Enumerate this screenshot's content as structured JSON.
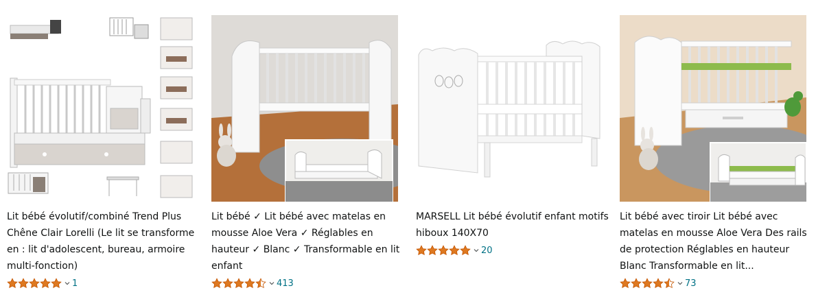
{
  "colors": {
    "star": "#de7921",
    "star_empty": "#ffffff",
    "link": "#007185",
    "text": "#0f1111"
  },
  "products": [
    {
      "title": "Lit bébé évolutif/combiné Trend Plus Chêne Clair Lorelli (Le lit se transforme en : lit d'adolescent, bureau, armoire multi-fonction)",
      "stars": 5,
      "rating_count": "1",
      "image_icon": "convertible-crib-collage-image"
    },
    {
      "title": "Lit bébé ✓ Lit bébé avec matelas en mousse Aloe Vera ✓ Réglables en hauteur ✓ Blanc ✓ Transformable en lit enfant",
      "stars": 4.5,
      "rating_count": "413",
      "image_icon": "white-crib-with-teddy-image"
    },
    {
      "title": "MARSELL Lit bébé évolutif enfant motifs hiboux 140X70",
      "stars": 5,
      "rating_count": "20",
      "image_icon": "white-crib-owls-image"
    },
    {
      "title": "Lit bébé avec tiroir Lit bébé avec matelas en mousse Aloe Vera Des rails de protection Réglables en hauteur Blanc Transformable en lit...",
      "stars": 4.5,
      "rating_count": "73",
      "image_icon": "white-crib-drawer-image"
    }
  ]
}
